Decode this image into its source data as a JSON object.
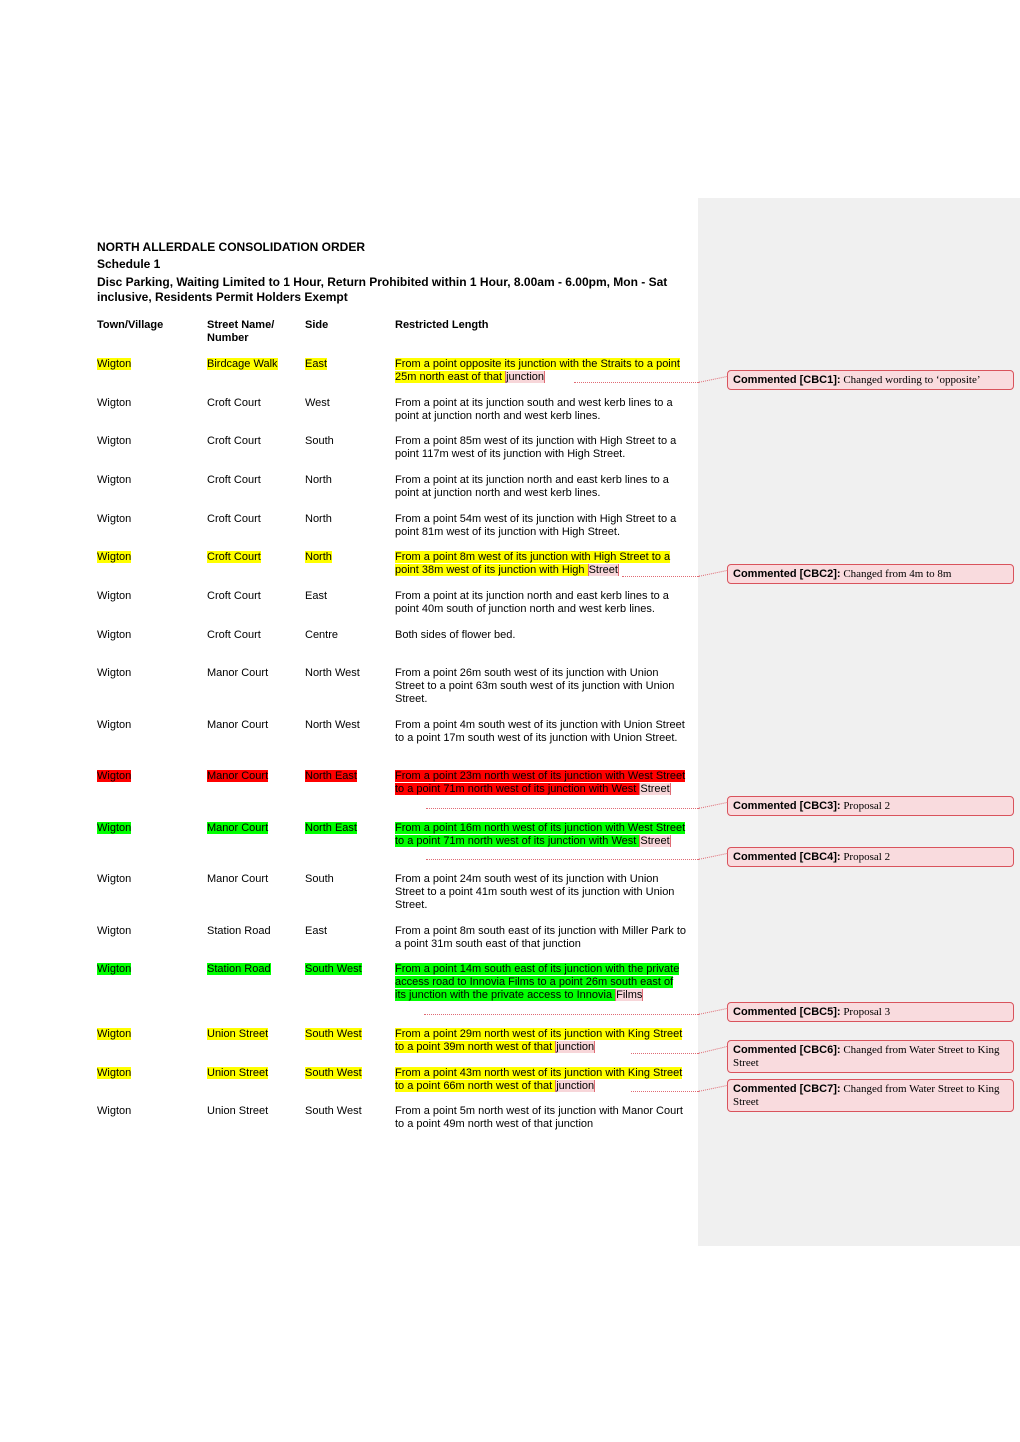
{
  "document": {
    "title": "NORTH ALLERDALE CONSOLIDATION ORDER",
    "schedule": "Schedule 1",
    "description": "Disc Parking, Waiting Limited to 1 Hour, Return Prohibited within 1 Hour, 8.00am - 6.00pm, Mon - Sat inclusive, Residents Permit Holders Exempt"
  },
  "table": {
    "headers": {
      "town": "Town/Village",
      "street": "Street Name/ Number",
      "side": "Side",
      "length": "Restricted Length"
    },
    "rows": [
      {
        "town": "Wigton",
        "street": "Birdcage Walk",
        "side": "East",
        "length_main": "From a point opposite its junction with the Straits to a point 25m north east of that ",
        "length_anchor": "junction",
        "highlight": "yellow",
        "comment": "CBC1"
      },
      {
        "town": "Wigton",
        "street": "Croft Court",
        "side": "West",
        "length_main": "From a point at its junction south and west kerb lines to a point at junction north and west kerb lines.",
        "length_anchor": "",
        "highlight": "none"
      },
      {
        "town": "Wigton",
        "street": "Croft Court",
        "side": "South",
        "length_main": "From a point 85m west of its junction with High Street to a point 117m west of its junction with High Street.",
        "length_anchor": "",
        "highlight": "none"
      },
      {
        "town": "Wigton",
        "street": "Croft Court",
        "side": "North",
        "length_main": "From a point at its junction north and east kerb lines to a point at junction north and west kerb lines.",
        "length_anchor": "",
        "highlight": "none"
      },
      {
        "town": "Wigton",
        "street": "Croft Court",
        "side": "North",
        "length_main": "From a point 54m west of its junction with High Street to a point 81m west of its junction with High Street.",
        "length_anchor": "",
        "highlight": "none"
      },
      {
        "town": "Wigton",
        "street": "Croft Court",
        "side": "North",
        "length_main": "From a point 8m west of its junction with High Street to a point 38m west of its junction with High ",
        "length_anchor": "Street",
        "highlight": "yellow",
        "comment": "CBC2"
      },
      {
        "town": "Wigton",
        "street": "Croft Court",
        "side": "East",
        "length_main": "From a point at its junction north and east kerb lines to a point 40m south of junction north and west kerb lines.",
        "length_anchor": "",
        "highlight": "none"
      },
      {
        "town": "Wigton",
        "street": "Croft Court",
        "side": "Centre",
        "length_main": "Both sides of flower bed.",
        "length_anchor": "",
        "highlight": "none"
      },
      {
        "town": "Wigton",
        "street": "Manor Court",
        "side": "North West",
        "length_main": "From a point 26m south west of its junction with Union Street to a point 63m south west of its junction with Union Street.",
        "length_anchor": "",
        "highlight": "none"
      },
      {
        "town": "Wigton",
        "street": "Manor Court",
        "side": "North West",
        "length_main": "From a point 4m south west of its junction with Union Street to a point 17m south west of its junction with Union Street.",
        "length_anchor": "",
        "highlight": "none"
      },
      {
        "town": "Wigton",
        "street": "Manor Court",
        "side": "North East",
        "length_main": "From a point 23m north west of its junction with West Street to a point 71m north west of its junction with West ",
        "length_anchor": "Street",
        "highlight": "red",
        "comment": "CBC3"
      },
      {
        "town": "Wigton",
        "street": "Manor Court",
        "side": "North East",
        "length_main": "From a point 16m north west of its junction with West Street to a point 71m north west of its junction with West ",
        "length_anchor": "Street",
        "highlight": "green",
        "comment": "CBC4"
      },
      {
        "town": "Wigton",
        "street": "Manor Court",
        "side": "South",
        "length_main": "From a point 24m south west of its junction with Union Street to a point 41m south west of its junction with Union Street.",
        "length_anchor": "",
        "highlight": "none"
      },
      {
        "town": "Wigton",
        "street": "Station Road",
        "side": "East",
        "length_main": "From a point 8m south east of its junction with Miller Park to a point 31m south east of that junction",
        "length_anchor": "",
        "highlight": "none"
      },
      {
        "town": "Wigton",
        "street": "Station Road",
        "side": "South West",
        "length_main": "From a point 14m south east of its junction with the private access road to Innovia Films to a point 26m south east of its junction with the private access to Innovia ",
        "length_anchor": "Films",
        "highlight": "green",
        "comment": "CBC5"
      },
      {
        "town": "Wigton",
        "street": "Union Street",
        "side": "South West",
        "length_main": "From a point 29m north west of its junction with King Street to a point 39m north west of that ",
        "length_anchor": "junction",
        "highlight": "yellow",
        "comment": "CBC6"
      },
      {
        "town": "Wigton",
        "street": "Union Street",
        "side": "South West",
        "length_main": "From a point 43m north west of its junction with King Street to a point 66m north west of that ",
        "length_anchor": "junction",
        "highlight": "yellow",
        "comment": "CBC7"
      },
      {
        "town": "Wigton",
        "street": "Union Street",
        "side": "South West",
        "length_main": "From a point 5m north west of its junction with Manor Court to a point 49m north west of that junction",
        "length_anchor": "",
        "highlight": "none"
      }
    ]
  },
  "comments": [
    {
      "id": "CBC1",
      "label": "Commented [CBC1]:",
      "text": " Changed wording to ‘opposite’"
    },
    {
      "id": "CBC2",
      "label": "Commented [CBC2]:",
      "text": " Changed from 4m to 8m"
    },
    {
      "id": "CBC3",
      "label": "Commented [CBC3]:",
      "text": " Proposal 2"
    },
    {
      "id": "CBC4",
      "label": "Commented [CBC4]:",
      "text": " Proposal 2"
    },
    {
      "id": "CBC5",
      "label": "Commented [CBC5]:",
      "text": " Proposal 3"
    },
    {
      "id": "CBC6",
      "label": "Commented [CBC6]:",
      "text": " Changed from Water Street to King Street"
    },
    {
      "id": "CBC7",
      "label": "Commented [CBC7]:",
      "text": " Changed from Water Street to King Street"
    }
  ],
  "colors": {
    "highlight_yellow": "#ffff00",
    "highlight_red": "#ff0000",
    "highlight_green": "#00ff00",
    "comment_fill": "#f9dbde",
    "comment_border": "#d9535c",
    "margin_panel": "#f0f0f0"
  }
}
